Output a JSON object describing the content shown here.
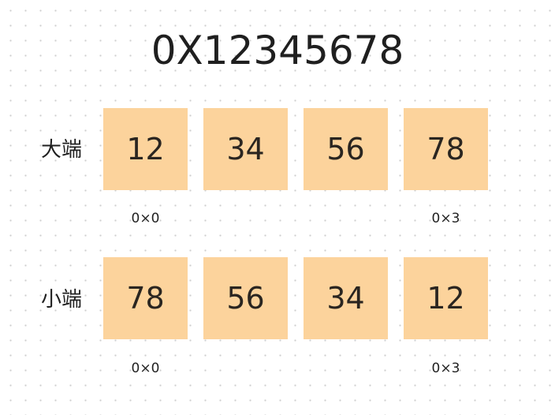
{
  "title": "0X12345678",
  "cell_color": "#fcd39c",
  "rows": [
    {
      "label": "大端",
      "cells": [
        "12",
        "34",
        "56",
        "78"
      ],
      "address_first": "0×0",
      "address_last": "0×3"
    },
    {
      "label": "小端",
      "cells": [
        "78",
        "56",
        "34",
        "12"
      ],
      "address_first": "0×0",
      "address_last": "0×3"
    }
  ]
}
